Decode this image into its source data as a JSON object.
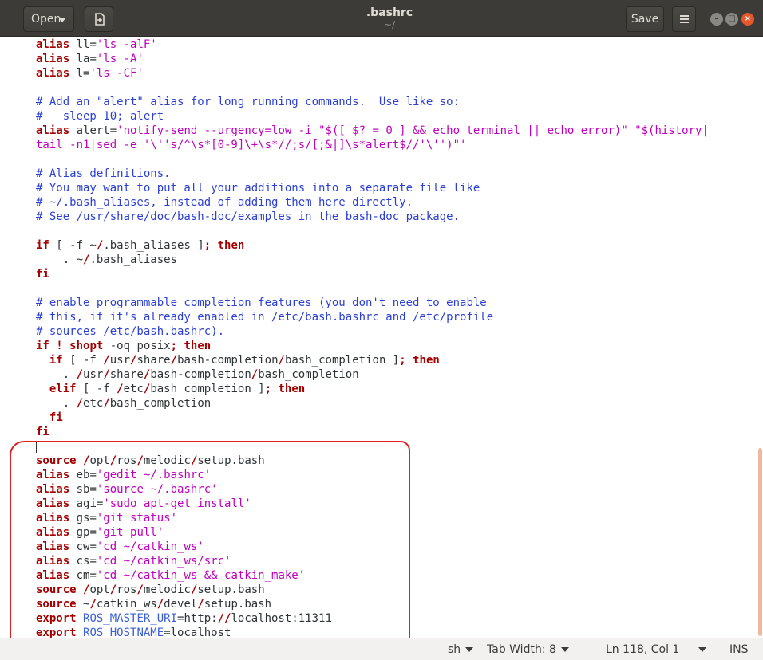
{
  "window": {
    "title": ".bashrc",
    "subtitle": "~/",
    "open_label": "Open",
    "save_label": "Save"
  },
  "statusbar": {
    "language": "sh",
    "tab_width": "Tab Width: 8",
    "position": "Ln 118, Col 1",
    "mode": "INS"
  },
  "icons": [
    "new-document-icon",
    "menu-icon",
    "minimize-icon",
    "maximize-icon",
    "close-icon"
  ],
  "colors": {
    "keyword": "#a40000",
    "string": "#c000c0",
    "comment": "#2b3fd6",
    "annotation": "#e02020"
  },
  "code_lines": [
    [
      [
        "kw",
        "alias"
      ],
      [
        "t",
        " ll="
      ],
      [
        "str",
        "'ls -alF'"
      ]
    ],
    [
      [
        "kw",
        "alias"
      ],
      [
        "t",
        " la="
      ],
      [
        "str",
        "'ls -A'"
      ]
    ],
    [
      [
        "kw",
        "alias"
      ],
      [
        "t",
        " l="
      ],
      [
        "str",
        "'ls -CF'"
      ]
    ],
    [],
    [
      [
        "cm",
        "# Add an \"alert\" alias for long running commands.  Use like so:"
      ]
    ],
    [
      [
        "cm",
        "#   sleep 10; alert"
      ]
    ],
    [
      [
        "kw",
        "alias"
      ],
      [
        "t",
        " alert="
      ],
      [
        "str",
        "'notify-send --urgency=low -i \"$([ $? = 0 ] && echo terminal || echo error)\" \"$(history|"
      ]
    ],
    [
      [
        "str",
        "tail -n1|sed -e '\\''s/^\\s*[0-9]\\+\\s*//;s/[;&|]\\s*alert$//'\\'')\"'"
      ]
    ],
    [],
    [
      [
        "cm",
        "# Alias definitions."
      ]
    ],
    [
      [
        "cm",
        "# You may want to put all your additions into a separate file like"
      ]
    ],
    [
      [
        "cm",
        "# ~/.bash_aliases, instead of adding them here directly."
      ]
    ],
    [
      [
        "cm",
        "# See /usr/share/doc/bash-doc/examples in the bash-doc package."
      ]
    ],
    [],
    [
      [
        "kw",
        "if"
      ],
      [
        "t",
        " [ -f ~"
      ],
      [
        "sl",
        "/"
      ],
      [
        "t",
        ".bash_aliases ]"
      ],
      [
        "kw",
        "; then"
      ]
    ],
    [
      [
        "t",
        "    . ~"
      ],
      [
        "sl",
        "/"
      ],
      [
        "t",
        ".bash_aliases"
      ]
    ],
    [
      [
        "kw",
        "fi"
      ]
    ],
    [],
    [
      [
        "cm",
        "# enable programmable completion features (you don't need to enable"
      ]
    ],
    [
      [
        "cm",
        "# this, if it's already enabled in /etc/bash.bashrc and /etc/profile"
      ]
    ],
    [
      [
        "cm",
        "# sources /etc/bash.bashrc)."
      ]
    ],
    [
      [
        "kw",
        "if"
      ],
      [
        "t",
        " "
      ],
      [
        "kw",
        "!"
      ],
      [
        "t",
        " "
      ],
      [
        "kw",
        "shopt"
      ],
      [
        "t",
        " -oq posix"
      ],
      [
        "kw",
        "; then"
      ]
    ],
    [
      [
        "t",
        "  "
      ],
      [
        "kw",
        "if"
      ],
      [
        "t",
        " [ -f "
      ],
      [
        "sl",
        "/"
      ],
      [
        "t",
        "usr"
      ],
      [
        "sl",
        "/"
      ],
      [
        "t",
        "share"
      ],
      [
        "sl",
        "/"
      ],
      [
        "t",
        "bash-completion"
      ],
      [
        "sl",
        "/"
      ],
      [
        "t",
        "bash_completion ]"
      ],
      [
        "kw",
        "; then"
      ]
    ],
    [
      [
        "t",
        "    . "
      ],
      [
        "sl",
        "/"
      ],
      [
        "t",
        "usr"
      ],
      [
        "sl",
        "/"
      ],
      [
        "t",
        "share"
      ],
      [
        "sl",
        "/"
      ],
      [
        "t",
        "bash-completion"
      ],
      [
        "sl",
        "/"
      ],
      [
        "t",
        "bash_completion"
      ]
    ],
    [
      [
        "t",
        "  "
      ],
      [
        "kw",
        "elif"
      ],
      [
        "t",
        " [ -f "
      ],
      [
        "sl",
        "/"
      ],
      [
        "t",
        "etc"
      ],
      [
        "sl",
        "/"
      ],
      [
        "t",
        "bash_completion ]"
      ],
      [
        "kw",
        "; then"
      ]
    ],
    [
      [
        "t",
        "    . "
      ],
      [
        "sl",
        "/"
      ],
      [
        "t",
        "etc"
      ],
      [
        "sl",
        "/"
      ],
      [
        "t",
        "bash_completion"
      ]
    ],
    [
      [
        "t",
        "  "
      ],
      [
        "kw",
        "fi"
      ]
    ],
    [
      [
        "kw",
        "fi"
      ]
    ],
    [
      [
        "cursor",
        ""
      ]
    ],
    [
      [
        "kw",
        "source"
      ],
      [
        "t",
        " "
      ],
      [
        "sl",
        "/"
      ],
      [
        "t",
        "opt"
      ],
      [
        "sl",
        "/"
      ],
      [
        "t",
        "ros"
      ],
      [
        "sl",
        "/"
      ],
      [
        "t",
        "melodic"
      ],
      [
        "sl",
        "/"
      ],
      [
        "t",
        "setup.bash"
      ]
    ],
    [
      [
        "kw",
        "alias"
      ],
      [
        "t",
        " eb="
      ],
      [
        "str",
        "'gedit ~/.bashrc'"
      ]
    ],
    [
      [
        "kw",
        "alias"
      ],
      [
        "t",
        " sb="
      ],
      [
        "str",
        "'source ~/.bashrc'"
      ]
    ],
    [
      [
        "kw",
        "alias"
      ],
      [
        "t",
        " agi="
      ],
      [
        "str",
        "'sudo apt-get install'"
      ]
    ],
    [
      [
        "kw",
        "alias"
      ],
      [
        "t",
        " gs="
      ],
      [
        "str",
        "'git status'"
      ]
    ],
    [
      [
        "kw",
        "alias"
      ],
      [
        "t",
        " gp="
      ],
      [
        "str",
        "'git pull'"
      ]
    ],
    [
      [
        "kw",
        "alias"
      ],
      [
        "t",
        " cw="
      ],
      [
        "str",
        "'cd ~/catkin_ws'"
      ]
    ],
    [
      [
        "kw",
        "alias"
      ],
      [
        "t",
        " cs="
      ],
      [
        "str",
        "'cd ~/catkin_ws/src'"
      ]
    ],
    [
      [
        "kw",
        "alias"
      ],
      [
        "t",
        " cm="
      ],
      [
        "str",
        "'cd ~/catkin_ws && catkin_make'"
      ]
    ],
    [
      [
        "kw",
        "source"
      ],
      [
        "t",
        " "
      ],
      [
        "sl",
        "/"
      ],
      [
        "t",
        "opt"
      ],
      [
        "sl",
        "/"
      ],
      [
        "t",
        "ros"
      ],
      [
        "sl",
        "/"
      ],
      [
        "t",
        "melodic"
      ],
      [
        "sl",
        "/"
      ],
      [
        "t",
        "setup.bash"
      ]
    ],
    [
      [
        "kw",
        "source"
      ],
      [
        "t",
        " ~"
      ],
      [
        "sl",
        "/"
      ],
      [
        "t",
        "catkin_ws"
      ],
      [
        "sl",
        "/"
      ],
      [
        "t",
        "devel"
      ],
      [
        "sl",
        "/"
      ],
      [
        "t",
        "setup.bash"
      ]
    ],
    [
      [
        "kw",
        "export"
      ],
      [
        "t",
        " "
      ],
      [
        "var",
        "ROS_MASTER_URI"
      ],
      [
        "t",
        "=http:"
      ],
      [
        "sl",
        "//"
      ],
      [
        "t",
        "localhost:11311"
      ]
    ],
    [
      [
        "kw",
        "export"
      ],
      [
        "t",
        " "
      ],
      [
        "var",
        "ROS_HOSTNAME"
      ],
      [
        "t",
        "=localhost"
      ]
    ]
  ]
}
